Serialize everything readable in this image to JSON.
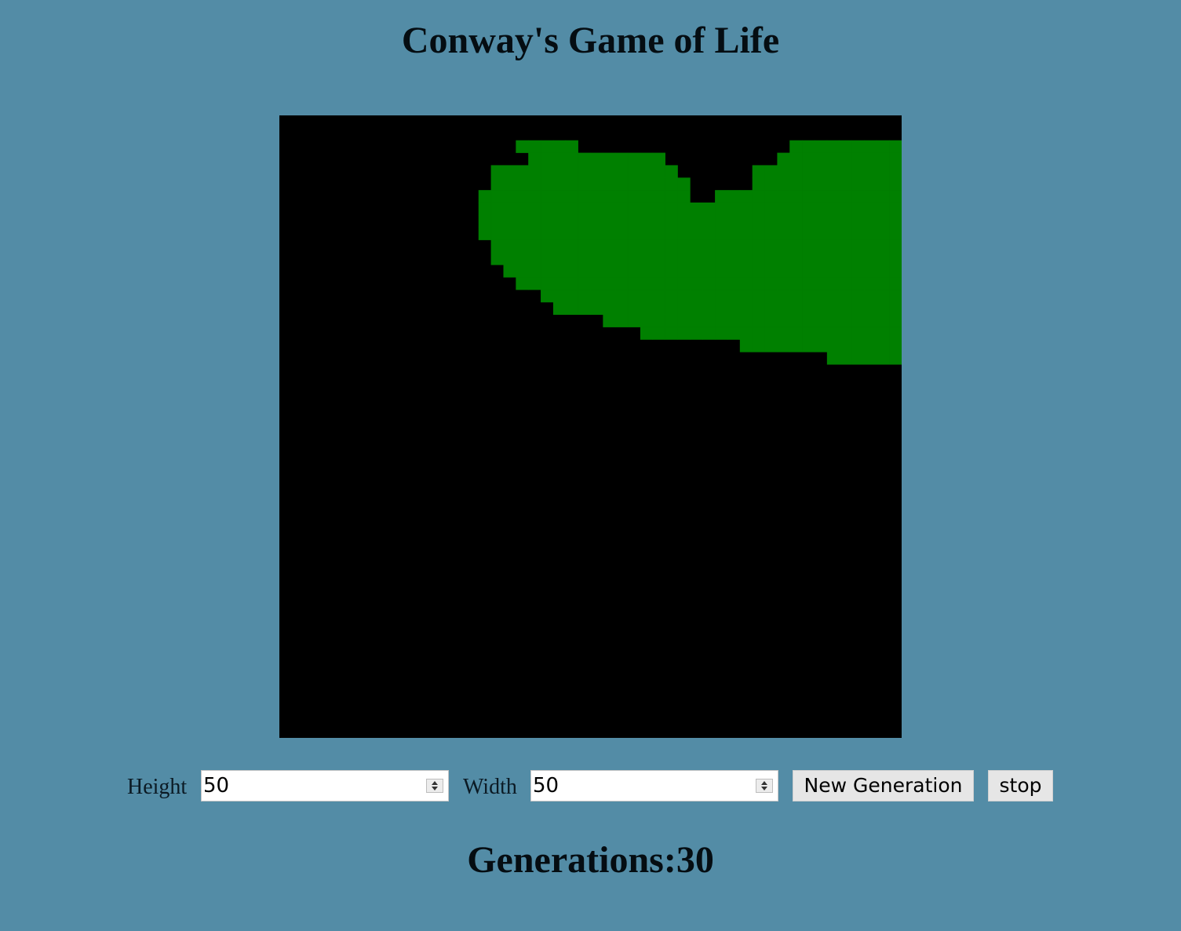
{
  "header": {
    "title": "Conway's Game of Life"
  },
  "grid": {
    "rows": 50,
    "cols": 50,
    "alive_color": "#008000",
    "dead_color": "#000000",
    "alive_cells": "2,19|2,20|2,21|2,22|2,23|2,41|2,42|2,43|2,44|2,45|2,46|2,47|2,48|2,49|2,50|2,51|3,20|3,21|3,22|3,23|3,24|3,25|3,26|3,27|3,28|3,29|3,30|3,40|3,41|3,42|3,43|3,44|3,45|3,46|3,47|3,48|3,49|3,50|3,51|4,17|4,18|4,19|4,20|4,21|4,22|4,23|4,24|4,25|4,26|4,27|4,28|4,29|4,30|4,31|4,38|4,39|4,40|4,41|4,42|4,43|4,44|4,45|4,46|4,47|4,48|4,49|4,50|4,51|4,52|5,17|5,18|5,19|5,20|5,21|5,22|5,23|5,24|5,25|5,26|5,27|5,28|5,29|5,30|5,31|5,32|5,38|5,39|5,40|5,41|5,42|5,43|5,44|5,45|5,46|5,47|5,48|5,49|5,50|5,51|5,52|6,16|6,17|6,18|6,19|6,20|6,21|6,22|6,23|6,24|6,25|6,26|6,27|6,28|6,29|6,30|6,31|6,32|6,35|6,36|6,37|6,38|6,39|6,40|6,41|6,42|6,43|6,44|6,45|6,46|6,47|6,48|6,49|6,50|6,51|6,52|7,16|7,17|7,18|7,19|7,20|7,21|7,22|7,23|7,24|7,25|7,26|7,27|7,28|7,29|7,30|7,31|7,32|7,33|7,34|7,35|7,36|7,37|7,38|7,39|7,40|7,41|7,42|7,43|7,44|7,45|7,46|7,47|7,48|7,49|7,50|7,51|7,52|8,16|8,17|8,18|8,19|8,20|8,21|8,22|8,23|8,24|8,25|8,26|8,27|8,28|8,29|8,30|8,31|8,32|8,33|8,34|8,35|8,36|8,37|8,38|8,39|8,40|8,41|8,42|8,43|8,44|8,45|8,46|8,47|8,48|8,49|8,50|8,51|8,52|8,53|9,16|9,17|9,18|9,19|9,20|9,21|9,22|9,23|9,24|9,25|9,26|9,27|9,28|9,29|9,30|9,31|9,32|9,33|9,34|9,35|9,36|9,37|9,38|9,39|9,40|9,41|9,42|9,43|9,44|9,45|9,46|9,47|9,48|9,49|9,50|9,51|9,52|9,53|10,17|10,18|10,19|10,20|10,21|10,22|10,23|10,24|10,25|10,26|10,27|10,28|10,29|10,30|10,31|10,32|10,33|10,34|10,35|10,36|10,37|10,38|10,39|10,40|10,41|10,42|10,43|10,44|10,45|10,46|10,47|10,48|10,49|10,50|10,51|10,52|10,53|11,17|11,18|11,19|11,20|11,21|11,22|11,23|11,24|11,25|11,26|11,27|11,28|11,29|11,30|11,31|11,32|11,33|11,34|11,35|11,36|11,37|11,38|11,39|11,40|11,41|11,42|11,43|11,44|11,45|11,46|11,47|11,48|11,49|11,50|11,51|11,52|11,53|12,18|12,19|12,20|12,21|12,22|12,23|12,24|12,25|12,26|12,27|12,28|12,29|12,30|12,31|12,32|12,33|12,34|12,35|12,36|12,37|12,38|12,39|12,40|12,41|12,42|12,43|12,44|12,45|12,46|12,47|12,48|12,49|12,50|12,51|12,52|12,53|13,19|13,20|13,21|13,22|13,23|13,24|13,25|13,26|13,27|13,28|13,29|13,30|13,31|13,32|13,33|13,34|13,35|13,36|13,37|13,38|13,39|13,40|13,41|13,42|13,43|13,44|13,45|13,46|13,47|13,48|13,49|13,50|13,51|13,52|13,53|14,21|14,22|14,23|14,24|14,25|14,26|14,27|14,28|14,29|14,30|14,31|14,32|14,33|14,34|14,35|14,36|14,37|14,38|14,39|14,40|14,41|14,42|14,43|14,44|14,45|14,46|14,47|14,48|14,49|14,50|14,51|14,52|14,53|15,22|15,23|15,24|15,25|15,26|15,27|15,28|15,29|15,30|15,31|15,32|15,33|15,34|15,35|15,36|15,37|15,38|15,39|15,40|15,41|15,42|15,43|15,44|15,45|15,46|15,47|15,48|15,49|15,50|15,51|15,52|15,53|16,26|16,27|16,28|16,29|16,30|16,31|16,32|16,33|16,34|16,35|16,36|16,37|16,38|16,39|16,40|16,41|16,42|16,43|16,44|16,45|16,46|16,47|16,48|16,49|16,50|16,51|16,52|16,53|17,29|17,30|17,31|17,32|17,33|17,34|17,35|17,36|17,37|17,38|17,39|17,40|17,41|17,42|17,43|17,44|17,45|17,46|17,47|17,48|17,49|17,50|17,51|17,52|18,37|18,38|18,39|18,40|18,41|18,42|18,43|18,44|18,45|18,46|18,47|18,48|18,49|18,50|18,51|18,52|19,44|19,45|19,46|19,47|19,48|19,49|19,50|19,51"
  },
  "controls": {
    "height_label": "Height",
    "height_value": "50",
    "width_label": "Width",
    "width_value": "50",
    "new_generation_label": "New Generation",
    "stop_label": "stop"
  },
  "status": {
    "generations_text": "Generations:30"
  }
}
